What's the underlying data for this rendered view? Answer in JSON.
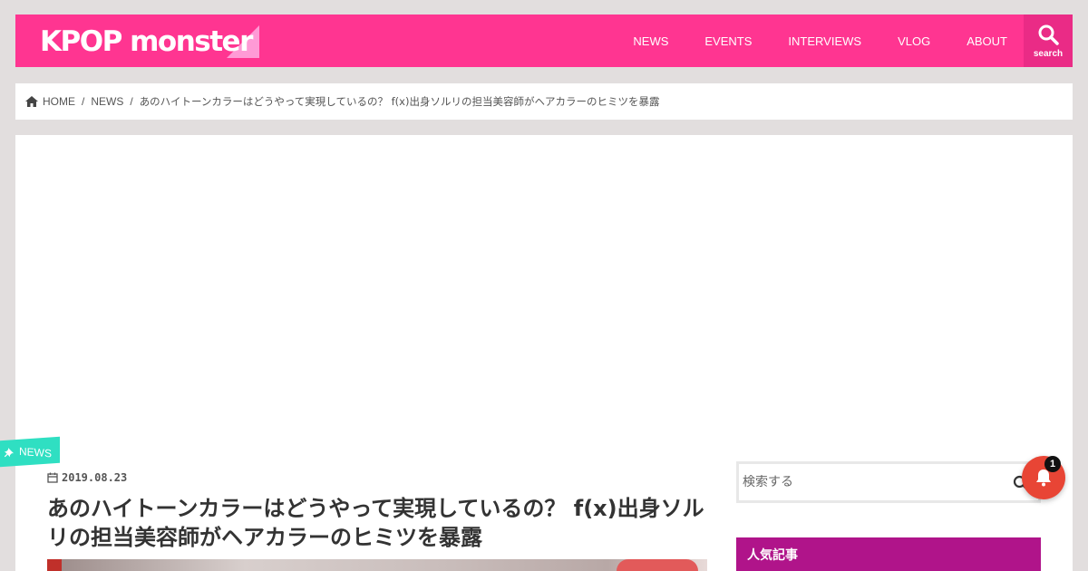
{
  "header": {
    "logo_text": "KPOP monster",
    "nav": [
      "NEWS",
      "EVENTS",
      "INTERVIEWS",
      "VLOG",
      "ABOUT"
    ],
    "search_label": "search"
  },
  "breadcrumb": {
    "home": "HOME",
    "category": "NEWS",
    "current": "あのハイトーンカラーはどうやって実現しているの？ f(x)出身ソルリの担当美容師がヘアカラーのヒミツを暴露"
  },
  "post": {
    "category": "NEWS",
    "date": "2019.08.23",
    "title": "あのハイトーンカラーはどうやって実現しているの？ f(x)出身ソルリの担当美容師がヘアカラーのヒミツを暴露"
  },
  "sidebar": {
    "search_placeholder": "検索する",
    "widget_title": "人気記事"
  },
  "notification": {
    "count": "1"
  },
  "colors": {
    "brand": "#ff3591",
    "accent_teal": "#2fdfc2",
    "widget": "#b0148a",
    "notification": "#e84535"
  }
}
